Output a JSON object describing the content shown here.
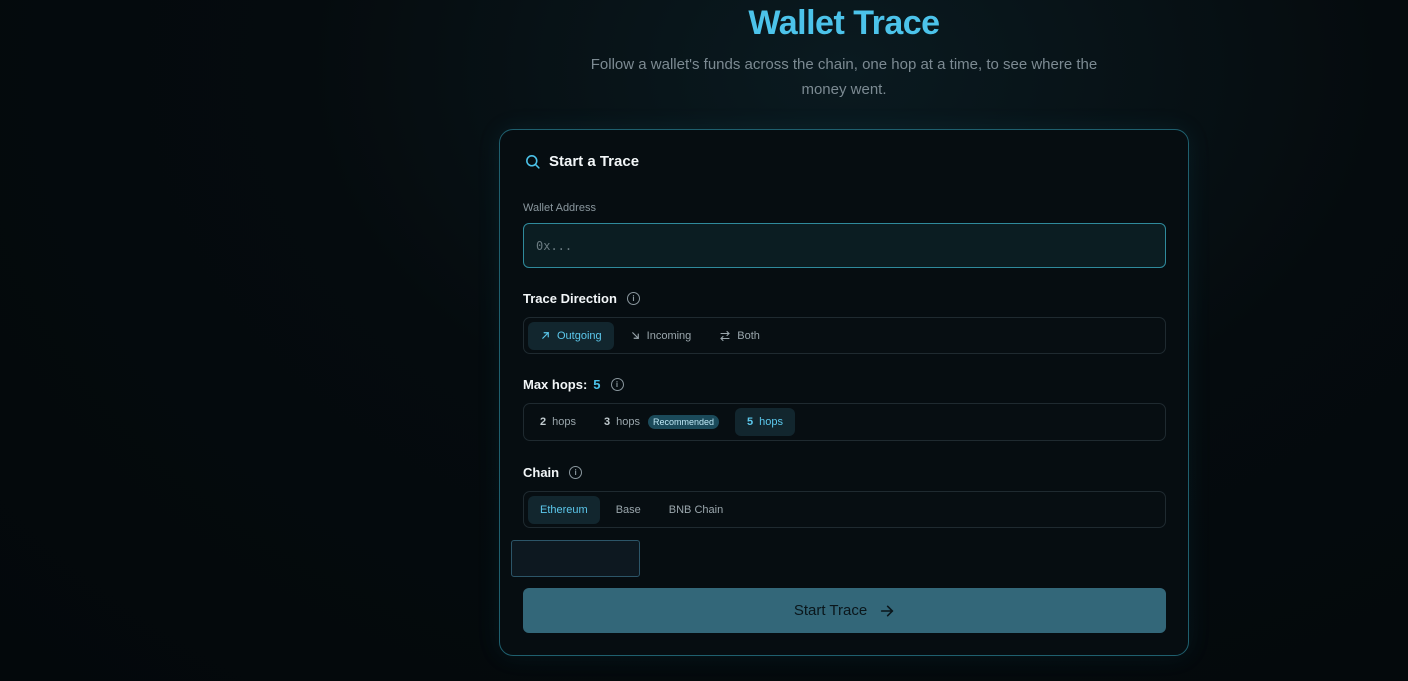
{
  "hero": {
    "title": "Wallet Trace",
    "subtitle": "Follow a wallet's funds across the chain, one hop at a time, to see where the money went."
  },
  "card": {
    "heading": "Start a Trace",
    "wallet": {
      "label": "Wallet Address",
      "value": "",
      "placeholder": "0x..."
    },
    "direction": {
      "label": "Trace Direction",
      "options": [
        {
          "label": "Outgoing",
          "icon": "arrow-up-right-icon",
          "active": true
        },
        {
          "label": "Incoming",
          "icon": "arrow-down-right-icon",
          "active": false
        },
        {
          "label": "Both",
          "icon": "swap-icon",
          "active": false
        }
      ]
    },
    "hops": {
      "label": "Max hops:",
      "value": "5",
      "unit": "hops",
      "options": [
        {
          "num": "2",
          "unit": "hops",
          "active": false
        },
        {
          "num": "3",
          "unit": "hops",
          "badge": "Recommended",
          "active": false
        },
        {
          "num": "5",
          "unit": "hops",
          "active": true
        }
      ]
    },
    "chain": {
      "label": "Chain",
      "options": [
        {
          "label": "Ethereum",
          "active": true
        },
        {
          "label": "Base",
          "active": false
        },
        {
          "label": "BNB Chain",
          "active": false
        }
      ]
    },
    "cta_label": "Start Trace"
  },
  "colors": {
    "accent": "#4cc3ea",
    "cta_bg": "#336779",
    "card_border": "#1f5f6e"
  }
}
